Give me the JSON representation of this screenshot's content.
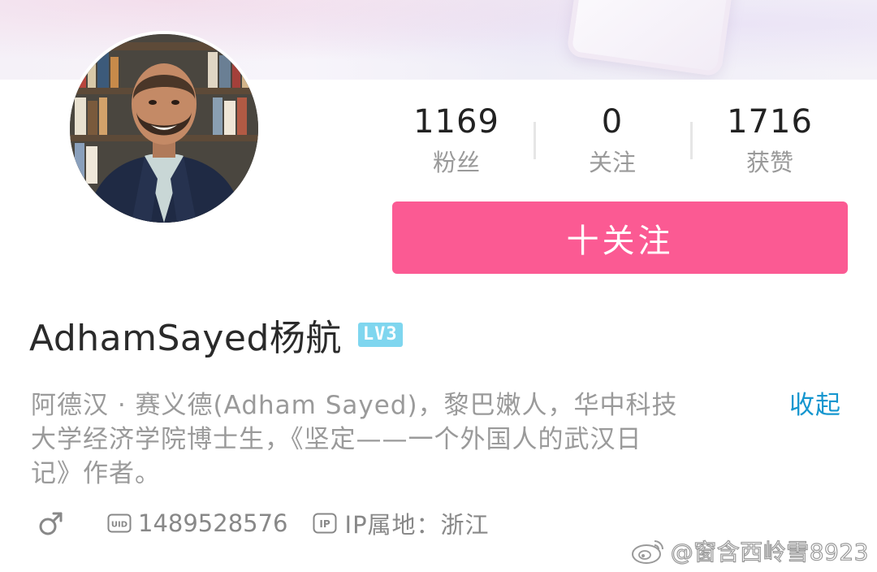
{
  "stats": [
    {
      "value": "1169",
      "label": "粉丝"
    },
    {
      "value": "0",
      "label": "关注"
    },
    {
      "value": "1716",
      "label": "获赞"
    }
  ],
  "follow_button": {
    "label": "十关注",
    "color": "#fb5a93"
  },
  "profile": {
    "username": "AdhamSayed杨航",
    "level": "LV3",
    "bio_lines": [
      "阿德汉 · 赛义德(Adham  Sayed)，黎巴嫩人，华中科技",
      "大学经济学院博士生，《坚定——一个外国人的武汉日",
      "记》作者。"
    ],
    "collapse_label": "收起",
    "uid": "1489528576",
    "ip_location": "IP属地：浙江"
  },
  "icons": {
    "gender": "male-icon",
    "uid": "uid-icon",
    "ip": "ip-icon",
    "watermark": "weibo-icon"
  },
  "watermark": {
    "text": "@窗含西岭雪8923"
  },
  "colors": {
    "accent": "#fb5a93",
    "link": "#1596cf",
    "level_badge": "#7fd6ef"
  }
}
